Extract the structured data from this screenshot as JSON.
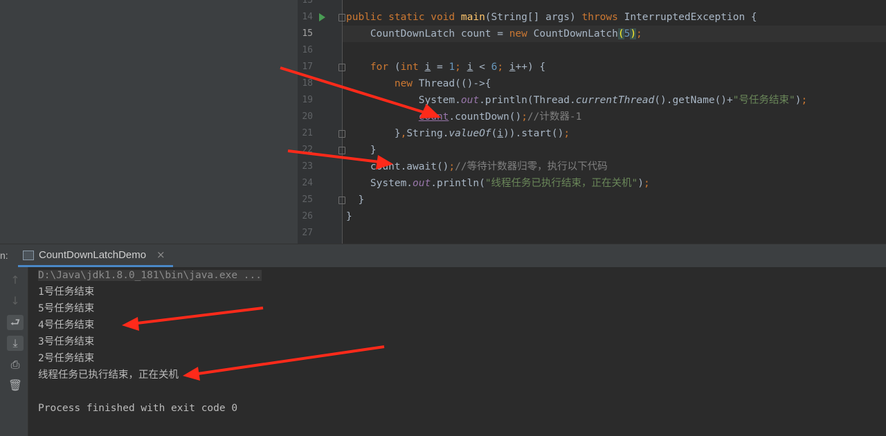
{
  "editor": {
    "line_numbers": [
      "13",
      "14",
      "15",
      "16",
      "17",
      "18",
      "19",
      "20",
      "21",
      "22",
      "23",
      "24",
      "25",
      "26",
      "27"
    ],
    "current_line": "15",
    "lines": [
      [],
      [
        [
          "kw",
          "public static void "
        ],
        [
          "fn",
          "main"
        ],
        [
          "var",
          "(String[] args) "
        ],
        [
          "kw",
          "throws "
        ],
        [
          "var",
          "InterruptedException {"
        ]
      ],
      [
        [
          "var",
          "    CountDownLatch count = "
        ],
        [
          "kw",
          "new "
        ],
        [
          "var",
          "CountDownLatch"
        ],
        [
          "brace",
          "("
        ],
        [
          "num",
          "5"
        ],
        [
          "brace",
          ")"
        ],
        [
          "kw",
          ";"
        ]
      ],
      [],
      [
        [
          "kw",
          "    for "
        ],
        [
          "var",
          "("
        ],
        [
          "kw",
          "int "
        ],
        [
          "ul",
          "i"
        ],
        [
          "var",
          " = "
        ],
        [
          "num",
          "1"
        ],
        [
          "kw",
          "; "
        ],
        [
          "ul",
          "i"
        ],
        [
          "var",
          " < "
        ],
        [
          "num",
          "6"
        ],
        [
          "kw",
          "; "
        ],
        [
          "ul",
          "i"
        ],
        [
          "var",
          "++) {"
        ]
      ],
      [
        [
          "kw",
          "        new "
        ],
        [
          "var",
          "Thread(()->{"
        ]
      ],
      [
        [
          "var",
          "            System."
        ],
        [
          "it",
          "out"
        ],
        [
          "var",
          ".println(Thread."
        ],
        [
          "itn",
          "currentThread"
        ],
        [
          "var",
          "().getName()+"
        ],
        [
          "str",
          "\"号任务结束\""
        ],
        [
          "var",
          ")"
        ],
        [
          "kw",
          ";"
        ]
      ],
      [
        [
          "var",
          "            "
        ],
        [
          "field-ul",
          "count"
        ],
        [
          "var",
          ".countDown()"
        ],
        [
          "kw",
          ";"
        ],
        [
          "cmt",
          "//计数器-1"
        ]
      ],
      [
        [
          "var",
          "        }"
        ],
        [
          "kw",
          ","
        ],
        [
          "var",
          "String."
        ],
        [
          "itn",
          "valueOf"
        ],
        [
          "var",
          "("
        ],
        [
          "ul",
          "i"
        ],
        [
          "var",
          ")).start()"
        ],
        [
          "kw",
          ";"
        ]
      ],
      [
        [
          "var",
          "    }"
        ]
      ],
      [
        [
          "var",
          "    count.await()"
        ],
        [
          "kw",
          ";"
        ],
        [
          "cmt",
          "//等待计数器归零，执行以下代码"
        ]
      ],
      [
        [
          "var",
          "    System."
        ],
        [
          "it",
          "out"
        ],
        [
          "var",
          ".println("
        ],
        [
          "str",
          "\"线程任务已执行结束，正在关机\""
        ],
        [
          "var",
          ")"
        ],
        [
          "kw",
          ";"
        ]
      ],
      [
        [
          "var",
          "  }"
        ]
      ],
      [
        [
          "var",
          "}"
        ]
      ],
      []
    ]
  },
  "run_panel": {
    "label": "n:",
    "tab_title": "CountDownLatchDemo",
    "close_glyph": "×",
    "toolbar_icons": [
      "up-arrow-icon",
      "down-arrow-icon",
      "soft-wrap-icon",
      "scroll-to-end-icon",
      "print-icon",
      "trash-icon"
    ],
    "console_lines": [
      "D:\\Java\\jdk1.8.0_181\\bin\\java.exe ...",
      "1号任务结束",
      "5号任务结束",
      "4号任务结束",
      "3号任务结束",
      "2号任务结束",
      "线程任务已执行结束，正在关机",
      "",
      "Process finished with exit code 0"
    ]
  },
  "colors": {
    "keyword": "#cc7832",
    "function": "#ffc66d",
    "number": "#6897bb",
    "string": "#6a8759",
    "comment": "#808080",
    "field": "#9876aa",
    "annotation_arrow": "#ff2a1a"
  }
}
